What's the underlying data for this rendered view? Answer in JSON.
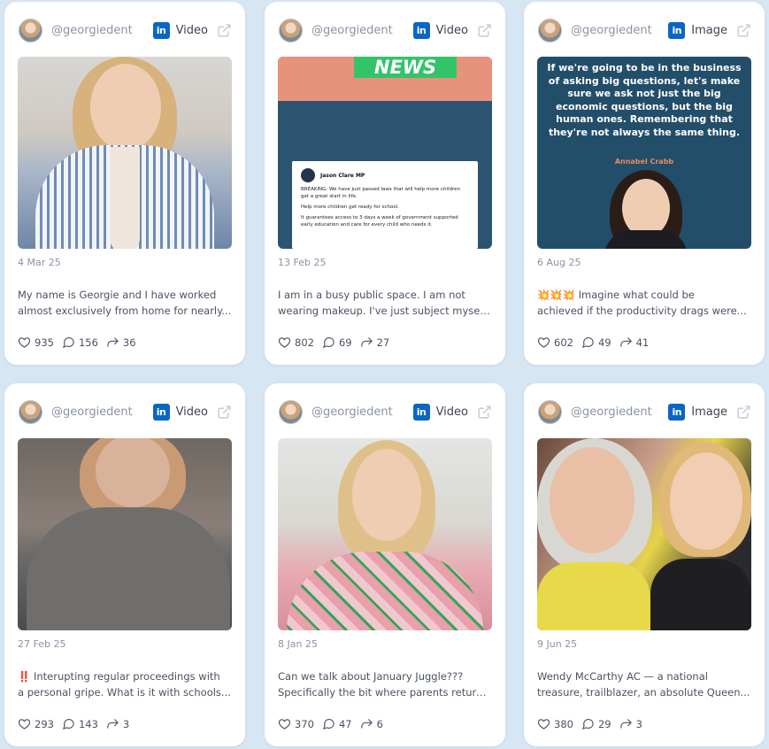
{
  "cards": [
    {
      "handle": "@georgiedent",
      "network_icon": "linkedin-icon",
      "media_type": "Video",
      "date": "4 Mar 25",
      "text_line1": "My name is Georgie and I have worked",
      "text_line2": "almost exclusively from home for nearly...",
      "likes": "935",
      "comments": "156",
      "shares": "36"
    },
    {
      "handle": "@georgiedent",
      "network_icon": "linkedin-icon",
      "media_type": "Video",
      "date": "13 Feb 25",
      "text_line1": "I am in a busy public space. I am not",
      "text_line2": "wearing makeup. I've just subject myself...",
      "likes": "802",
      "comments": "69",
      "shares": "27",
      "media": {
        "news_tag": "NEWS",
        "tweet_author": "Jason Clare MP",
        "tweet_lines": [
          "BREAKING: We have just passed laws that will help more children get a great start in life.",
          "Help more children get ready for school.",
          "It guarantees access to 3 days a week of government supported early education and care for every child who needs it."
        ]
      }
    },
    {
      "handle": "@georgiedent",
      "network_icon": "linkedin-icon",
      "media_type": "Image",
      "date": "6 Aug 25",
      "text_line1": "💥💥💥 Imagine what could be",
      "text_line2": "achieved if the productivity drags were...",
      "likes": "602",
      "comments": "49",
      "shares": "41",
      "media": {
        "quote": "If we're going to be in the business of asking big questions, let's make sure we ask not just the big economic questions, but the big human ones. Remembering that they're not always the same thing.",
        "quote_author": "Annabel Crabb"
      }
    },
    {
      "handle": "@georgiedent",
      "network_icon": "linkedin-icon",
      "media_type": "Video",
      "date": "27 Feb 25",
      "text_line1": "‼️ Interupting regular proceedings with",
      "text_line2": "a personal gripe. What is it with schools...",
      "likes": "293",
      "comments": "143",
      "shares": "3"
    },
    {
      "handle": "@georgiedent",
      "network_icon": "linkedin-icon",
      "media_type": "Video",
      "date": "8 Jan 25",
      "text_line1": "Can we talk about January Juggle???",
      "text_line2": "Specifically the bit where parents return...",
      "likes": "370",
      "comments": "47",
      "shares": "6"
    },
    {
      "handle": "@georgiedent",
      "network_icon": "linkedin-icon",
      "media_type": "Image",
      "date": "9 Jun 25",
      "text_line1": "Wendy McCarthy AC — a national",
      "text_line2": "treasure, trailblazer, an absolute Queen...",
      "likes": "380",
      "comments": "29",
      "shares": "3"
    }
  ],
  "colors": {
    "background": "#d7e6f3",
    "card": "#ffffff",
    "linkedin": "#0a66c2",
    "muted_text": "#8a93a3",
    "body_text": "#4a5261"
  },
  "icons": {
    "like": "heart-icon",
    "comment": "comment-icon",
    "share": "share-icon",
    "open_external": "external-link-icon"
  }
}
